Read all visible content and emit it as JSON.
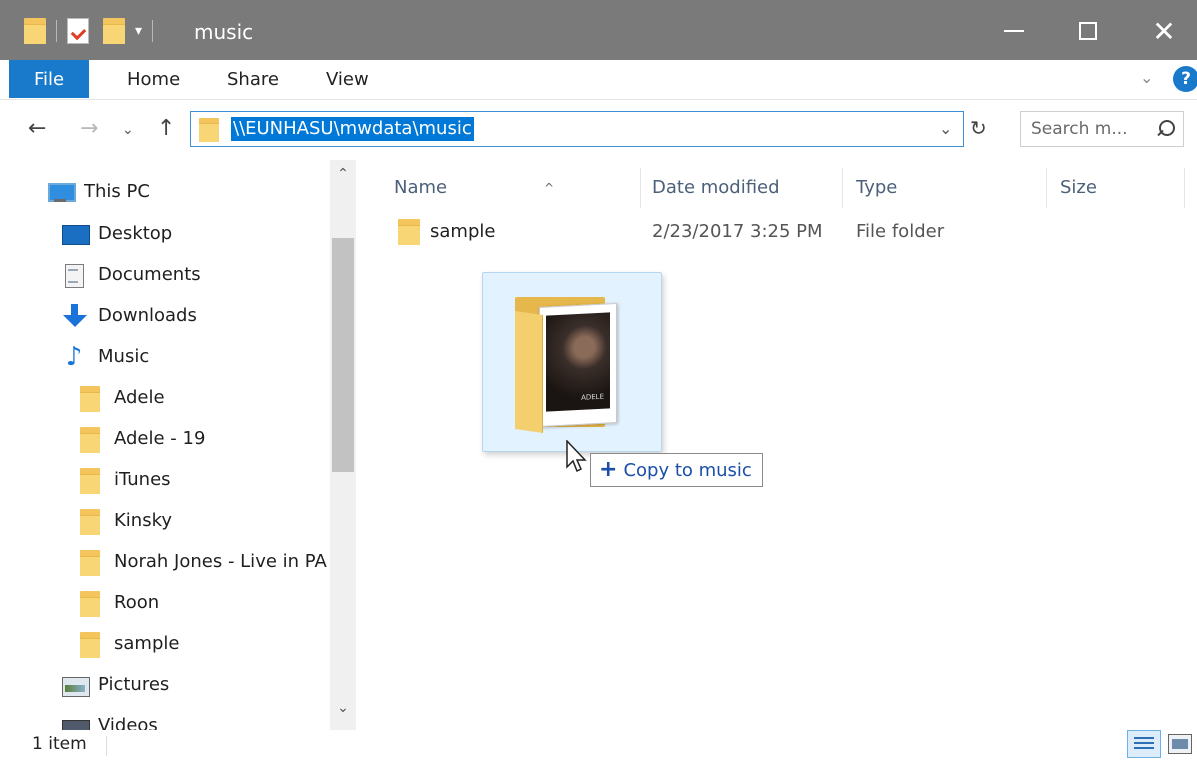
{
  "window": {
    "title": "music",
    "qat_dropdown": "▾",
    "minimize_icon": "minimize-icon",
    "maximize_icon": "maximize-icon",
    "close_glyph": "✕"
  },
  "ribbon": {
    "tabs": [
      {
        "label": "File",
        "active": true
      },
      {
        "label": "Home"
      },
      {
        "label": "Share"
      },
      {
        "label": "View"
      }
    ],
    "expand_glyph": "⌄",
    "help_label": "?"
  },
  "nav": {
    "back_glyph": "←",
    "forward_glyph": "→",
    "recent_glyph": "⌄",
    "up_glyph": "↑",
    "address_path": "\\\\EUNHASU\\mwdata\\music",
    "address_chevron": "⌄",
    "refresh_glyph": "↻",
    "search_placeholder": "Search m..."
  },
  "sidebar": {
    "items": [
      {
        "label": "This PC",
        "icon": "computer-icon"
      },
      {
        "label": "Desktop",
        "icon": "desktop-icon"
      },
      {
        "label": "Documents",
        "icon": "documents-icon"
      },
      {
        "label": "Downloads",
        "icon": "downloads-icon"
      },
      {
        "label": "Music",
        "icon": "music-icon",
        "glyph": "♪"
      },
      {
        "label": "Adele",
        "icon": "folder-icon"
      },
      {
        "label": "Adele - 19",
        "icon": "folder-icon"
      },
      {
        "label": "iTunes",
        "icon": "folder-icon"
      },
      {
        "label": "Kinsky",
        "icon": "folder-icon"
      },
      {
        "label": "Norah Jones - Live in PA",
        "icon": "folder-icon"
      },
      {
        "label": "Roon",
        "icon": "folder-icon"
      },
      {
        "label": "sample",
        "icon": "folder-icon"
      },
      {
        "label": "Pictures",
        "icon": "pictures-icon"
      },
      {
        "label": "Videos",
        "icon": "videos-icon"
      }
    ],
    "scroll_up_glyph": "⌃",
    "scroll_down_glyph": "⌄"
  },
  "content": {
    "columns": [
      "Name",
      "Date modified",
      "Type",
      "Size"
    ],
    "sort_glyph": "^",
    "files": [
      {
        "name": "sample",
        "date_modified": "2/23/2017 3:25 PM",
        "type": "File folder",
        "size": ""
      }
    ]
  },
  "drag": {
    "album_text": "ADELE",
    "tooltip_plus": "+",
    "tooltip_label": "Copy to music"
  },
  "status": {
    "item_count": "1 item"
  },
  "colors": {
    "titlebar": "#7a7a7a",
    "accent": "#1979ca",
    "selection": "#0078d7",
    "folder": "#f8d676"
  }
}
